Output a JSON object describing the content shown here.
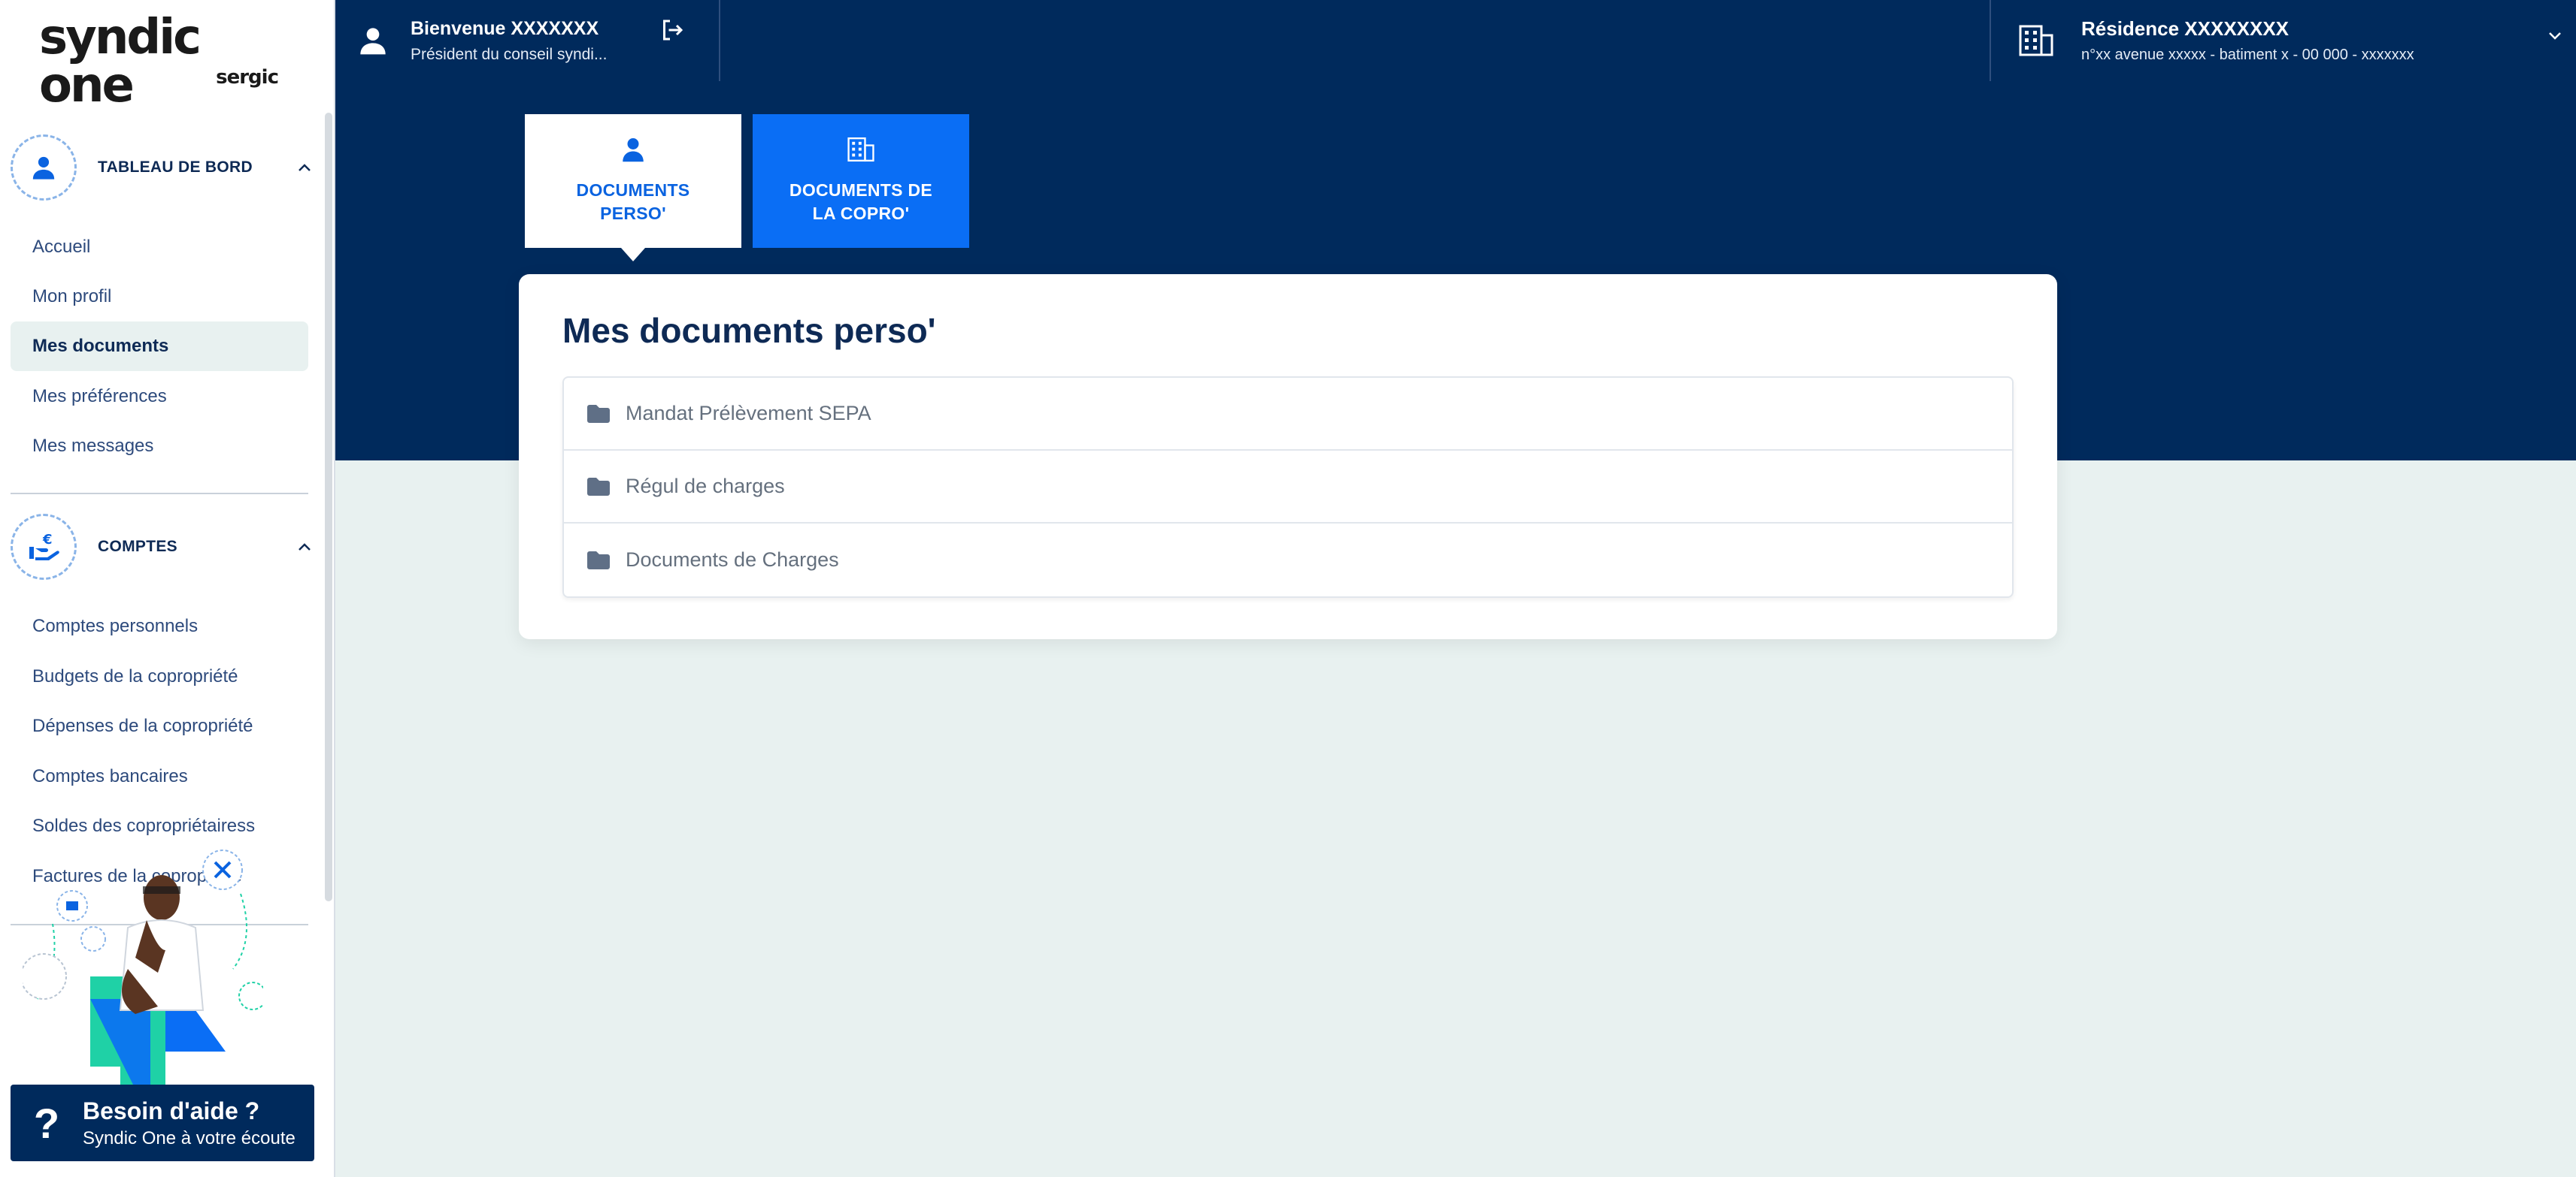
{
  "brand": {
    "name": "syndic one",
    "sub": "sergic"
  },
  "header": {
    "welcome_label": "Bienvenue",
    "user_name": "XXXXXXX",
    "user_role": "Président du conseil syndi...",
    "residence_name": "Résidence XXXXXXXX",
    "residence_address": "n°xx avenue xxxxx - batiment x - 00 000 - xxxxxxx"
  },
  "sidebar": {
    "sections": [
      {
        "title": "TABLEAU DE BORD",
        "items": [
          {
            "label": "Accueil",
            "active": false
          },
          {
            "label": "Mon profil",
            "active": false
          },
          {
            "label": "Mes documents",
            "active": true
          },
          {
            "label": "Mes préférences",
            "active": false
          },
          {
            "label": "Mes messages",
            "active": false
          }
        ]
      },
      {
        "title": "COMPTES",
        "items": [
          {
            "label": "Comptes personnels"
          },
          {
            "label": "Budgets de la copropriété"
          },
          {
            "label": "Dépenses de la copropriété"
          },
          {
            "label": "Comptes bancaires"
          },
          {
            "label": "Soldes des copropriétairess"
          },
          {
            "label": "Factures de la copropriété"
          }
        ]
      }
    ]
  },
  "help": {
    "title": "Besoin d'aide ?",
    "subtitle": "Syndic One à votre écoute"
  },
  "tabs": [
    {
      "label": "DOCUMENTS PERSO'",
      "line1": "DOCUMENTS",
      "line2": "PERSO'",
      "active": true,
      "icon": "user-icon"
    },
    {
      "label": "DOCUMENTS DE LA COPRO'",
      "line1": "DOCUMENTS DE",
      "line2": "LA COPRO'",
      "active": false,
      "icon": "building-icon"
    }
  ],
  "main": {
    "title": "Mes documents perso'",
    "folders": [
      {
        "name": "Mandat Prélèvement SEPA"
      },
      {
        "name": "Régul de charges"
      },
      {
        "name": "Documents de Charges"
      }
    ]
  },
  "colors": {
    "navy": "#002a5c",
    "accent": "#0a6ef5",
    "page_bg": "#e8f1f0"
  }
}
